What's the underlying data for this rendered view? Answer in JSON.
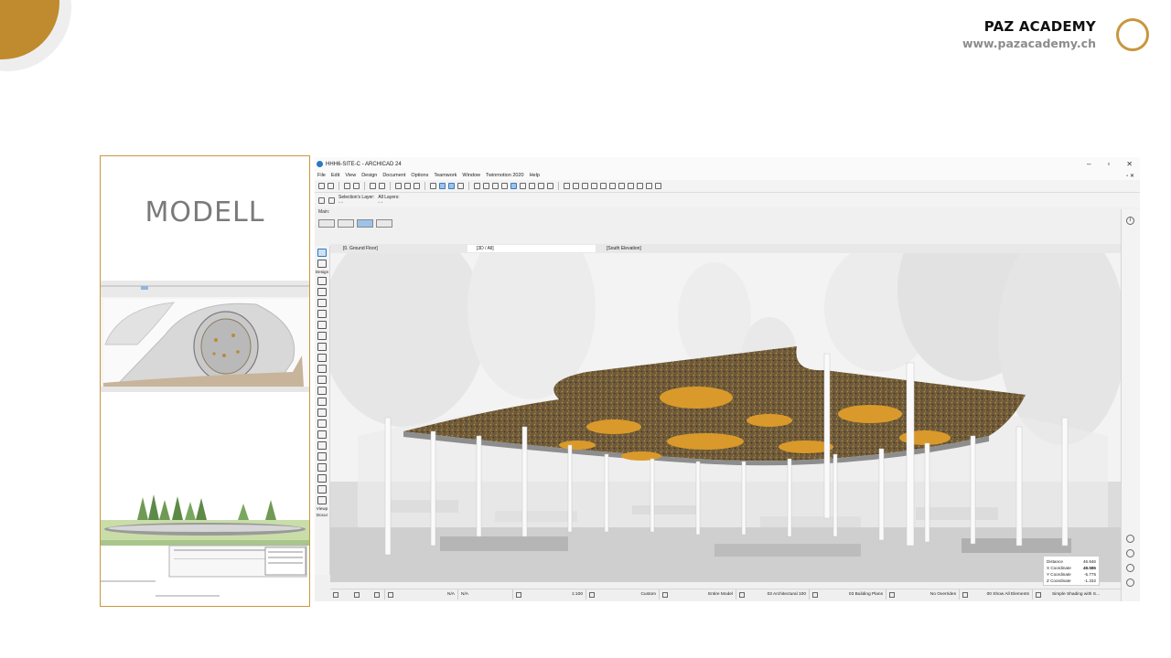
{
  "brand": {
    "name": "PAZ ACADEMY",
    "url": "www.pazacademy.ch"
  },
  "card": {
    "title": "MODELL"
  },
  "app": {
    "title": "HHH6-SITE-C - ARCHICAD 24",
    "window_controls": [
      "–",
      "▫",
      "✕"
    ],
    "menu": [
      "File",
      "Edit",
      "View",
      "Design",
      "Document",
      "Options",
      "Teamwork",
      "Window",
      "Twinmotion 2020",
      "Help"
    ],
    "info": {
      "selection_layer_label": "Selection's Layer:",
      "all_layers_label": "All Layers:"
    },
    "main_label": "Main:",
    "toolbox": {
      "design_label": "Design",
      "viewpoint_label": "Viewp",
      "document_label": "Docur"
    },
    "tabs": [
      {
        "label": "[0. Ground Floor]"
      },
      {
        "label": "[3D / All]"
      },
      {
        "label": "[South Elevation]"
      }
    ],
    "coordinates": {
      "distance_label": "Distance",
      "distance": "46.946",
      "x_label": "X Coordinate",
      "x": "48.586",
      "y_label": "Y Coordinate",
      "y": "-5.775",
      "z_label": "Z Coordinate",
      "z": "-1.332"
    },
    "status": {
      "zoom_a": "N/A",
      "zoom_b": "N/A",
      "scale": "1:100",
      "custom": "Custom",
      "model": "Entire Model",
      "pen_set": "03 Architectural 100",
      "model_view": "03 Building Plans",
      "overrides": "No Overrides",
      "renovation": "00 Show All Elements",
      "shading": "Simple Shading with S..."
    }
  },
  "colors": {
    "accent_gold": "#c9963d",
    "deco_gold": "#c08a2e",
    "canopy_dark": "#6e5a3a",
    "canopy_orange": "#d99a2b",
    "archicad_blue": "#2b78c5"
  }
}
